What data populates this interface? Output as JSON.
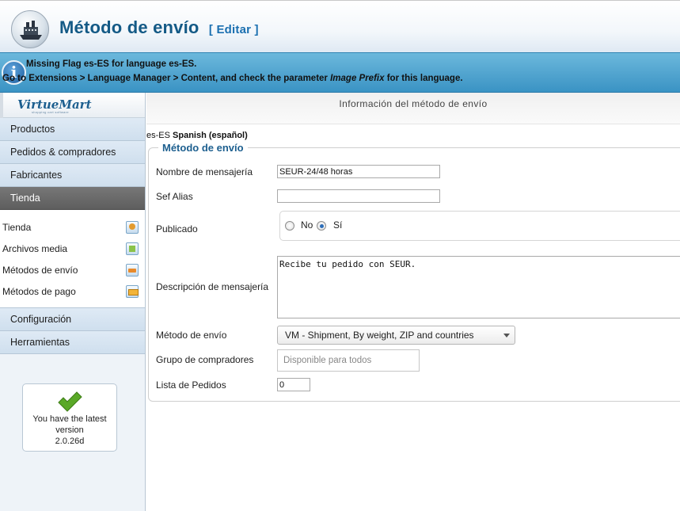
{
  "header": {
    "title": "Método de envío",
    "edit_tag": "[ Editar ]"
  },
  "notice": {
    "line1": "Missing Flag es-ES for language es-ES.",
    "line2_before": "Go to Extensions > Language Manager > Content, and check the parameter ",
    "line2_italic": "Image Prefix",
    "line2_after": " for this language."
  },
  "sidebar": {
    "logo_text": "VirtueMart",
    "logo_tagline": "shopping cart software",
    "items_top": [
      {
        "label": "Productos"
      },
      {
        "label": "Pedidos & compradores"
      },
      {
        "label": "Fabricantes"
      },
      {
        "label": "Tienda"
      }
    ],
    "subitems": [
      {
        "label": "Tienda",
        "icon": "store-icon"
      },
      {
        "label": "Archivos media",
        "icon": "media-icon"
      },
      {
        "label": "Métodos de envío",
        "icon": "shipping-truck-icon"
      },
      {
        "label": "Métodos de pago",
        "icon": "payment-card-icon"
      }
    ],
    "items_bottom": [
      {
        "label": "Configuración"
      },
      {
        "label": "Herramientas"
      }
    ],
    "version": {
      "line1": "You have the latest",
      "line2": "version",
      "line3": "2.0.26d"
    }
  },
  "main": {
    "section_title": "Información del método de envío",
    "language_code": "es-ES",
    "language_name": "Spanish (español)",
    "legend": "Método de envío",
    "fields": {
      "name_label": "Nombre de mensajería",
      "name_value": "SEUR-24/48 horas",
      "alias_label": "Sef Alias",
      "alias_value": "",
      "published_label": "Publicado",
      "published_no": "No",
      "published_yes": "Sí",
      "description_label": "Descripción de mensajería",
      "description_value": "Recibe tu pedido con SEUR.",
      "method_label": "Método de envío",
      "method_value": "VM - Shipment, By weight, ZIP and countries",
      "group_label": "Grupo de compradores",
      "group_placeholder": "Disponible para todos",
      "order_label": "Lista de Pedidos",
      "order_value": "0"
    }
  },
  "colors": {
    "title": "#145a86",
    "notice_bg": "#3a93c4",
    "active_nav": "#5e5e5e",
    "legend": "#1d5f8f"
  }
}
